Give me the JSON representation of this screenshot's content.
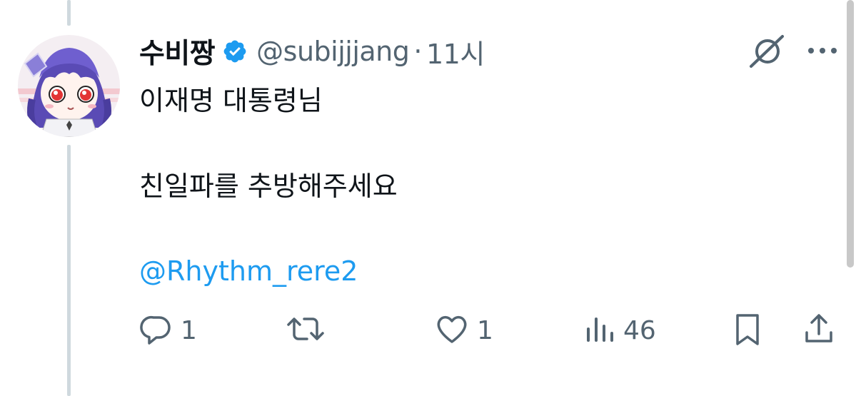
{
  "author": {
    "display_name": "수비짱",
    "handle": "@subijjjang",
    "separator": "·",
    "time": "11시",
    "verified": true
  },
  "tweet": {
    "line1": "이재명 대통령님",
    "line2": "친일파를 추방해주세요",
    "mention": "@Rhythm_rere2"
  },
  "actions": {
    "reply_count": "1",
    "retweet_count": "",
    "like_count": "1",
    "views_count": "46"
  },
  "colors": {
    "text": "#0f1419",
    "secondary": "#536471",
    "link": "#1d9bf0",
    "verified_badge": "#1d9bf0",
    "thread_line": "#cfd9de"
  },
  "icons": [
    "verified-badge-icon",
    "grok-icon",
    "more-icon",
    "reply-icon",
    "retweet-icon",
    "like-icon",
    "views-icon",
    "bookmark-icon",
    "share-icon"
  ]
}
